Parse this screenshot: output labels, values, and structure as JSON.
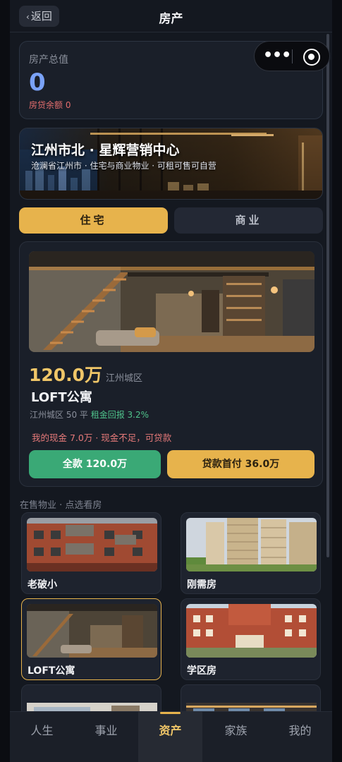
{
  "header": {
    "back_label": "返回",
    "title": "房产"
  },
  "summary": {
    "label": "房产总值",
    "value": "0",
    "loan_balance": "房贷余额 0"
  },
  "banner": {
    "title": "江州市北 · 星辉营销中心",
    "subtitle": "沧澜省江州市 · 住宅与商业物业 · 可租可售可自营"
  },
  "tabs": [
    {
      "label": "住宅",
      "active": true
    },
    {
      "label": "商业",
      "active": false
    }
  ],
  "featured": {
    "price": "120.0万",
    "district": "江州城区",
    "name": "LOFT公寓",
    "area_info": "江州城区 50 平",
    "yield": "租金回报 3.2%",
    "cash_notice": "我的现金 7.0万 · 现金不足，可贷款",
    "buy_full_label": "全款 120.0万",
    "buy_loan_label": "贷款首付 36.0万"
  },
  "listings": {
    "section_label": "在售物业 · 点选看房",
    "items": [
      {
        "name": "老破小",
        "selected": false
      },
      {
        "name": "刚需房",
        "selected": false
      },
      {
        "name": "LOFT公寓",
        "selected": true
      },
      {
        "name": "学区房",
        "selected": false
      }
    ]
  },
  "bottom_nav": [
    {
      "label": "人生",
      "active": false
    },
    {
      "label": "事业",
      "active": false
    },
    {
      "label": "资产",
      "active": true
    },
    {
      "label": "家族",
      "active": false
    },
    {
      "label": "我的",
      "active": false
    }
  ],
  "colors": {
    "accent_gold": "#e7b34c",
    "buy_green": "#3aa976",
    "value_blue": "#7aa2f7",
    "warn_red": "#e26d6d"
  },
  "icons": {
    "back": "chevron-left-icon",
    "more": "more-dots-icon",
    "close": "target-circle-icon"
  }
}
